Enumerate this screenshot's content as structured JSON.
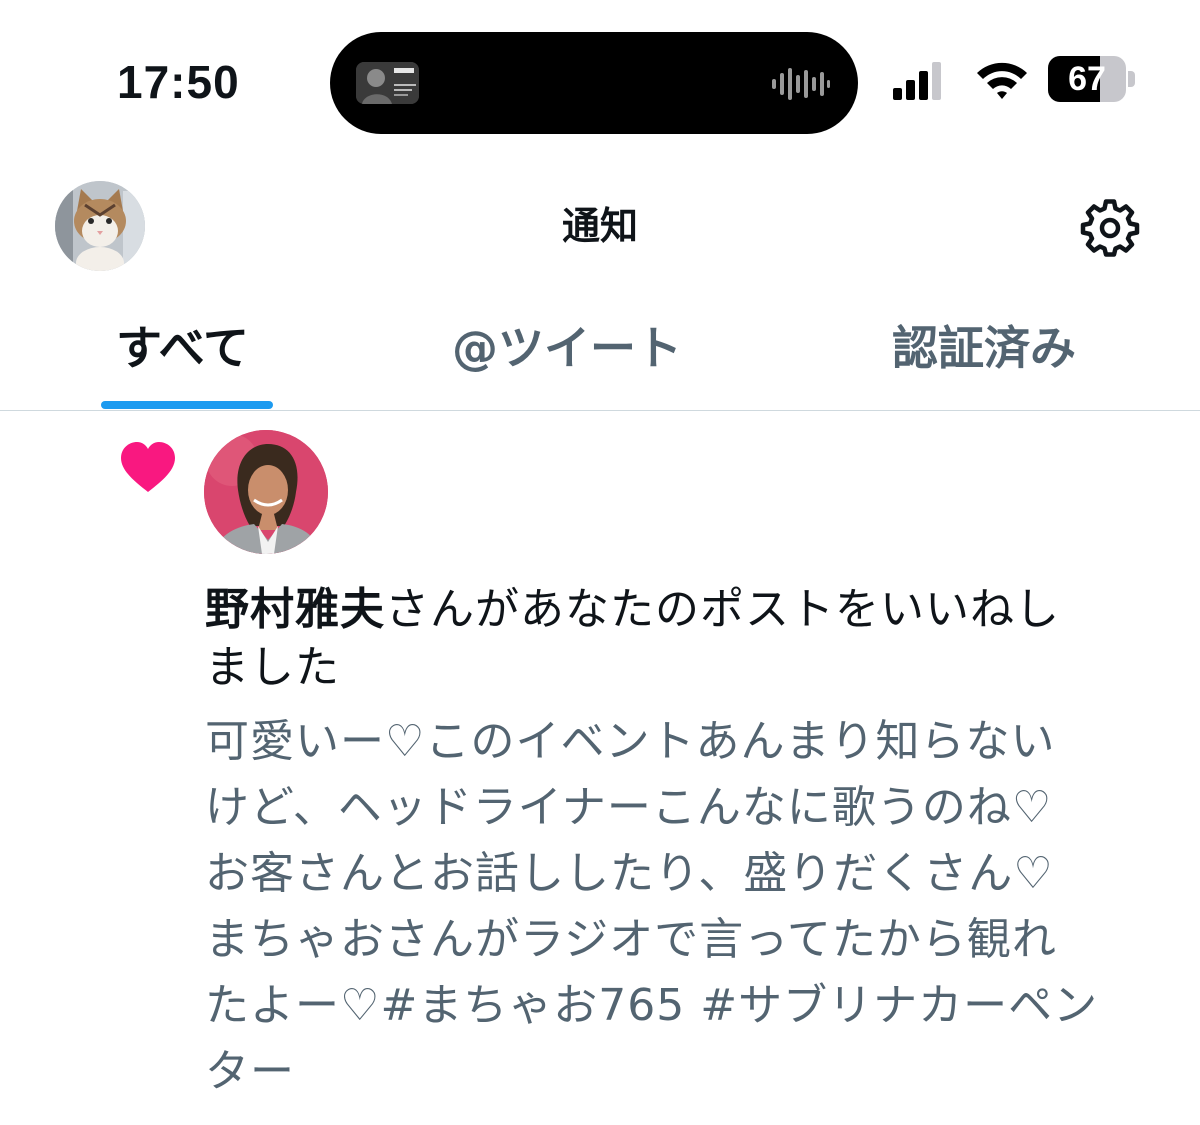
{
  "status_bar": {
    "time": "17:50",
    "battery": "67",
    "battery_level": 0.67
  },
  "header": {
    "title": "通知",
    "avatar_icon": "cat-avatar",
    "settings_icon": "gear-icon"
  },
  "tabs": [
    {
      "label": "すべて",
      "active": true
    },
    {
      "label": "@ツイート",
      "active": false
    },
    {
      "label": "認証済み",
      "active": false
    }
  ],
  "notification": {
    "type_icon": "heart-icon",
    "liker_name": "野村雅夫",
    "action_text": "さんがあなたのポストをいいねし",
    "action_text_2": "ました",
    "post_lines": [
      "可愛いー♡このイベントあんまり知らない",
      "けど、ヘッドライナーこんなに歌うのね♡",
      "お客さんとお話ししたり、盛りだくさん♡",
      "まちゃおさんがラジオで言ってたから観れ",
      "たよー♡#まちゃお765 #サブリナカーペン",
      "ター"
    ]
  },
  "colors": {
    "accent": "#1d9bf0",
    "like": "#f91880",
    "secondary_text": "#536471"
  }
}
